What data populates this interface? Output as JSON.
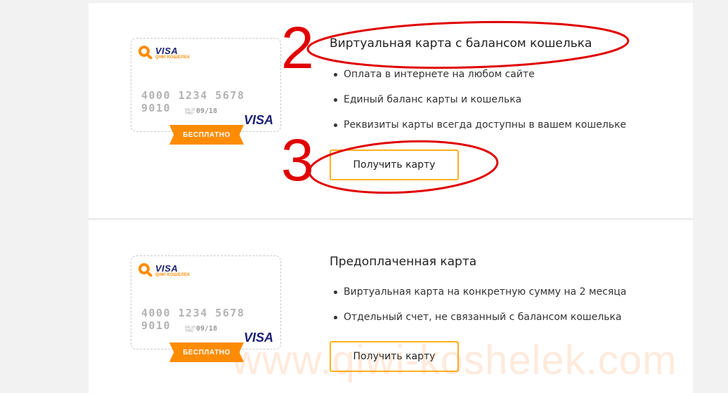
{
  "sections": [
    {
      "title": "Виртуальная карта с балансом кошелька",
      "bullets": [
        "Оплата в интернете на любом сайте",
        "Единый баланс карты и кошелька",
        "Реквизиты карты всегда доступны в вашем кошельке"
      ],
      "button_label": "Получить карту",
      "card": {
        "logo_text": "VISA",
        "logo_sub": "QIWI КОШЕЛЕК",
        "number": "4000 1234 5678 9010",
        "valid_label": "VALID THRU",
        "expiry": "09/18",
        "brand": "VISA",
        "badge": "БЕСПЛАТНО"
      }
    },
    {
      "title": "Предоплаченная карта",
      "bullets": [
        "Виртуальная карта на конкретную сумму на 2 месяца",
        "Отдельный счет, не связанный с балансом кошелька"
      ],
      "button_label": "Получить карту",
      "card": {
        "logo_text": "VISA",
        "logo_sub": "QIWI КОШЕЛЕК",
        "number": "4000 1234 5678 9010",
        "valid_label": "VALID THRU",
        "expiry": "09/18",
        "brand": "VISA",
        "badge": "БЕСПЛАТНО"
      }
    }
  ],
  "annotations": {
    "step2": "2",
    "step3": "3"
  },
  "watermark": "www.qiwi-koshelek.com",
  "colors": {
    "accent": "#ff8c00",
    "button_border": "#ffb020",
    "annotation": "#e00000",
    "visa_blue": "#1a1f71"
  }
}
